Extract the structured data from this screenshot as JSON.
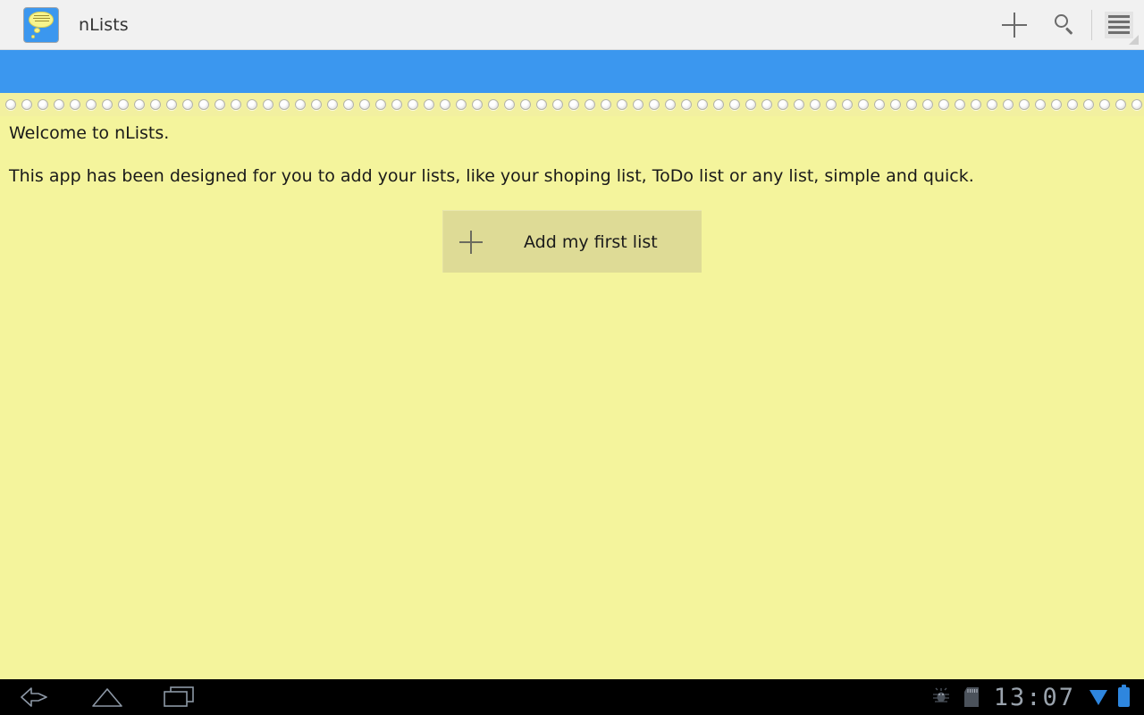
{
  "action_bar": {
    "app_icon_name": "nlists-app-icon",
    "title": "nLists",
    "actions": [
      {
        "name": "add-list-action",
        "icon": "plus-icon",
        "label": ""
      },
      {
        "name": "search-action",
        "icon": "search-icon",
        "label": ""
      },
      {
        "name": "overflow-menu-action",
        "icon": "hamburger-menu-icon",
        "label": ""
      }
    ],
    "bg_color": "#f1f1f1",
    "title_color": "#333333"
  },
  "blue_strip": {
    "color": "#3b97ef"
  },
  "holes_strip": {
    "hole_count": 71,
    "bg_color": "#f2f0a0"
  },
  "content": {
    "welcome_text": "Welcome to nLists.",
    "description_text": "This app has been designed for you to add your lists, like your shoping list, ToDo list or any list, simple and quick.",
    "bg_color": "#f4f49c",
    "add_button": {
      "label": "Add my first list",
      "icon": "plus-icon",
      "bg_color": "#dedb96"
    }
  },
  "nav_bar": {
    "bg_color": "#000000",
    "buttons": [
      {
        "name": "back-button",
        "icon": "back-arrow-icon"
      },
      {
        "name": "home-button",
        "icon": "home-icon"
      },
      {
        "name": "recents-button",
        "icon": "recent-apps-icon"
      }
    ],
    "status": {
      "debug_icon": "android-bug-icon",
      "sdcard_icon": "sd-card-icon",
      "clock": "13:07",
      "wifi_icon": "wifi-icon",
      "battery_icon": "battery-icon",
      "accent_color": "#2e86de",
      "clock_color": "#9aa3ad"
    }
  }
}
